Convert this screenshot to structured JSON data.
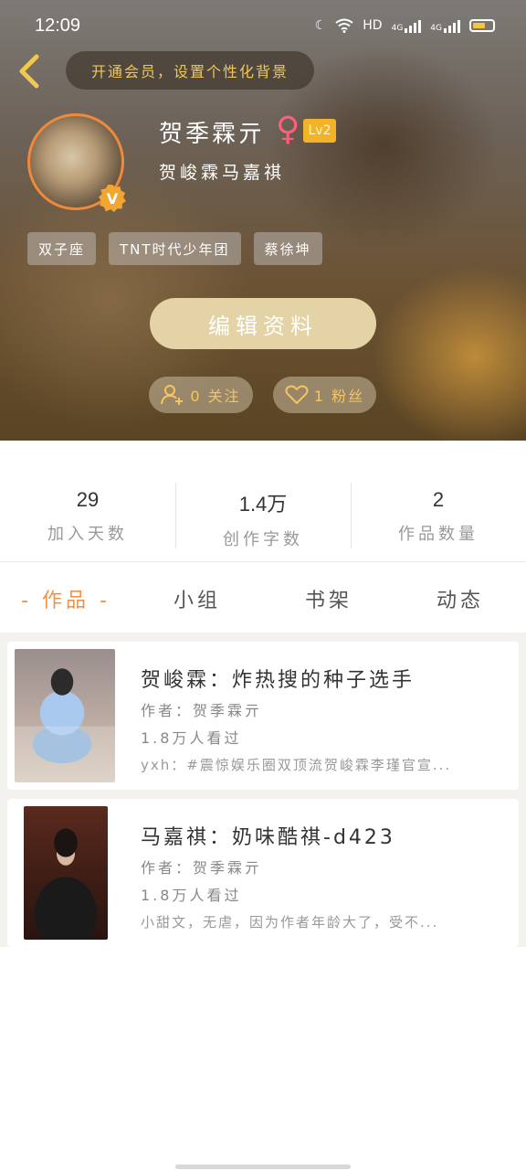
{
  "status_bar": {
    "time": "12:09",
    "network_label": "HD",
    "signal_1": "4G",
    "signal_2": "4G"
  },
  "header": {
    "back_icon": "chevron-left-icon",
    "vip_promo": "开通会员，设置个性化背景",
    "nickname": "贺季霖亓",
    "gender_symbol": "♀",
    "level": "Lv2",
    "signature": "贺峻霖马嘉祺",
    "avatar_badge": "V",
    "tags": [
      "双子座",
      "TNT时代少年团",
      "蔡徐坤"
    ],
    "edit_button": "编辑资料",
    "following": "0 关注",
    "followers": "1 粉丝",
    "accent_color": "#f3b329"
  },
  "stats": [
    {
      "value": "29",
      "label": "加入天数"
    },
    {
      "value": "1.4万",
      "label": "创作字数"
    },
    {
      "value": "2",
      "label": "作品数量"
    }
  ],
  "tabs": [
    {
      "label": "- 作品 -",
      "active": true
    },
    {
      "label": "小组",
      "active": false
    },
    {
      "label": "书架",
      "active": false
    },
    {
      "label": "动态",
      "active": false
    }
  ],
  "works": [
    {
      "title": "贺峻霖：炸热搜的种子选手",
      "author": "作者：贺季霖亓",
      "views": "1.8万人看过",
      "desc": "yxh：#震惊娱乐圈双顶流贺峻霖李瑾官宣..."
    },
    {
      "title": "马嘉祺：奶味酷祺-d423",
      "author": "作者：贺季霖亓",
      "views": "1.8万人看过",
      "desc": "小甜文，无虐，因为作者年龄大了，受不..."
    }
  ]
}
